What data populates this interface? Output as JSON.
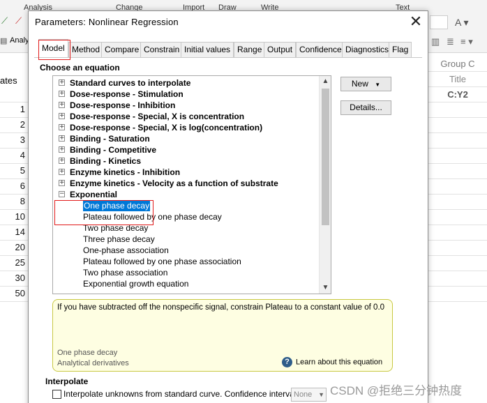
{
  "background_app": {
    "ribbon_groups": [
      "Analysis",
      "Change",
      "Import",
      "Draw",
      "Write",
      "Text"
    ],
    "analyze_label": "Analy",
    "row_label": "ates",
    "group_header": "Group C",
    "group_subheader": "Title",
    "column_header": "C:Y2",
    "row_numbers": [
      "1",
      "2",
      "3",
      "4",
      "5",
      "6",
      "8",
      "10",
      "14",
      "20",
      "25",
      "30",
      "50"
    ]
  },
  "dialog": {
    "title": "Parameters: Nonlinear Regression",
    "tabs": [
      "Model",
      "Method",
      "Compare",
      "Constrain",
      "Initial values",
      "Range",
      "Output",
      "Confidence",
      "Diagnostics",
      "Flag"
    ],
    "active_tab": "Model"
  },
  "equation_section": {
    "label": "Choose an equation",
    "categories": [
      "Standard curves to interpolate",
      "Dose-response - Stimulation",
      "Dose-response - Inhibition",
      "Dose-response - Special, X is concentration",
      "Dose-response - Special, X is log(concentration)",
      "Binding - Saturation",
      "Binding - Competitive",
      "Binding - Kinetics",
      "Enzyme kinetics - Inhibition",
      "Enzyme kinetics - Velocity as a function of substrate"
    ],
    "expanded_category": "Exponential",
    "expanded_children": [
      "One phase decay",
      "Plateau followed by one phase decay",
      "Two phase decay",
      "Three phase decay",
      "One-phase association",
      "Plateau followed by one phase association",
      "Two phase association",
      "Exponential growth equation"
    ],
    "selected": "One phase decay",
    "new_button": "New",
    "details_button": "Details..."
  },
  "info_box": {
    "text": "If you have subtracted off the nonspecific signal, constrain Plateau to a constant value of 0.0",
    "equation_name": "One phase decay",
    "derivatives": "Analytical derivatives",
    "learn_link": "Learn about this equation"
  },
  "interpolate": {
    "title": "Interpolate",
    "checkbox_label": "Interpolate unknowns from standard curve. Confidence interval:",
    "checked": false,
    "ci_value": "None"
  },
  "watermark": "CSDN @拒绝三分钟热度",
  "colors": {
    "selection": "#0078d7",
    "highlight_red": "#e11a1a",
    "info_bg": "#fefee2"
  },
  "icons": [
    "close-icon",
    "plus-box-icon",
    "minus-box-icon",
    "scroll-up-icon",
    "scroll-down-icon",
    "help-icon",
    "dropdown-icon"
  ]
}
